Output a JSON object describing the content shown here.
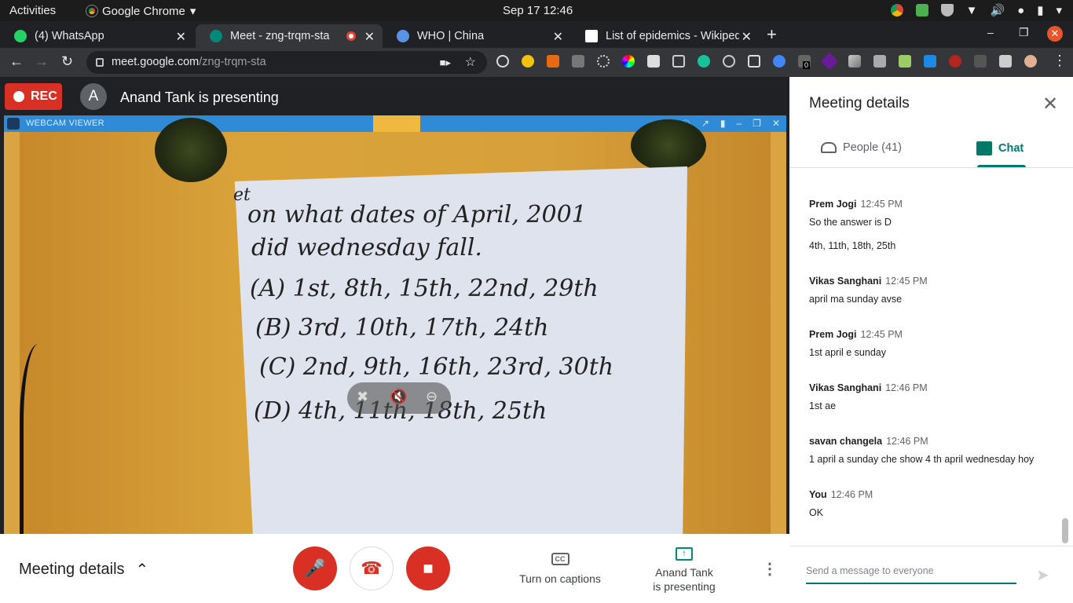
{
  "topbar": {
    "activities": "Activities",
    "app": "Google Chrome",
    "clock": "Sep 17  12:46"
  },
  "tabs": [
    {
      "label": "(4) WhatsApp",
      "color": "#25d366"
    },
    {
      "label": "Meet - zng-trqm-sta",
      "color": "#00897b"
    },
    {
      "label": "WHO | China",
      "color": "#5b92e5"
    },
    {
      "label": "List of epidemics - Wikipedia",
      "color": "#ffffff"
    }
  ],
  "omnibox": {
    "host": "meet.google.com",
    "path": "/zng-trqm-sta"
  },
  "extensions_badge": "0",
  "stage": {
    "rec": "REC",
    "presenter_initial": "A",
    "presenter_title": "Anand Tank is presenting",
    "webcam_title": "WEBCAM VIEWER"
  },
  "whiteboard": {
    "q_mark": "et",
    "line1": "on what dates of April, 2001",
    "line2": "did wednesday fall.",
    "optA": "(A) 1st, 8th, 15th, 22nd, 29th",
    "optB": "(B) 3rd, 10th, 17th, 24th",
    "optC": "(C) 2nd, 9th, 16th, 23rd, 30th",
    "optD": "(D) 4th, 11th, 18th, 25th"
  },
  "bottom": {
    "meeting_details": "Meeting details",
    "captions": "Turn on captions",
    "presenting_line1": "Anand Tank",
    "presenting_line2": "is presenting"
  },
  "panel": {
    "title": "Meeting details",
    "people_tab": "People (41)",
    "chat_tab": "Chat"
  },
  "chat": [
    {
      "name": "Prem Jogi",
      "time": "12:45 PM",
      "lines": [
        "So the answer is D",
        "4th, 11th, 18th, 25th"
      ]
    },
    {
      "name": "Vikas Sanghani",
      "time": "12:45 PM",
      "lines": [
        "april ma sunday avse"
      ]
    },
    {
      "name": "Prem Jogi",
      "time": "12:45 PM",
      "lines": [
        "1st april e sunday"
      ]
    },
    {
      "name": "Vikas Sanghani",
      "time": "12:46 PM",
      "lines": [
        "1st ae"
      ]
    },
    {
      "name": "savan changela",
      "time": "12:46 PM",
      "lines": [
        "1 april a sunday che show 4 th april wednesday hoy"
      ]
    },
    {
      "name": "You",
      "time": "12:46 PM",
      "lines": [
        "OK"
      ]
    }
  ],
  "composer": {
    "placeholder": "Send a message to everyone"
  }
}
